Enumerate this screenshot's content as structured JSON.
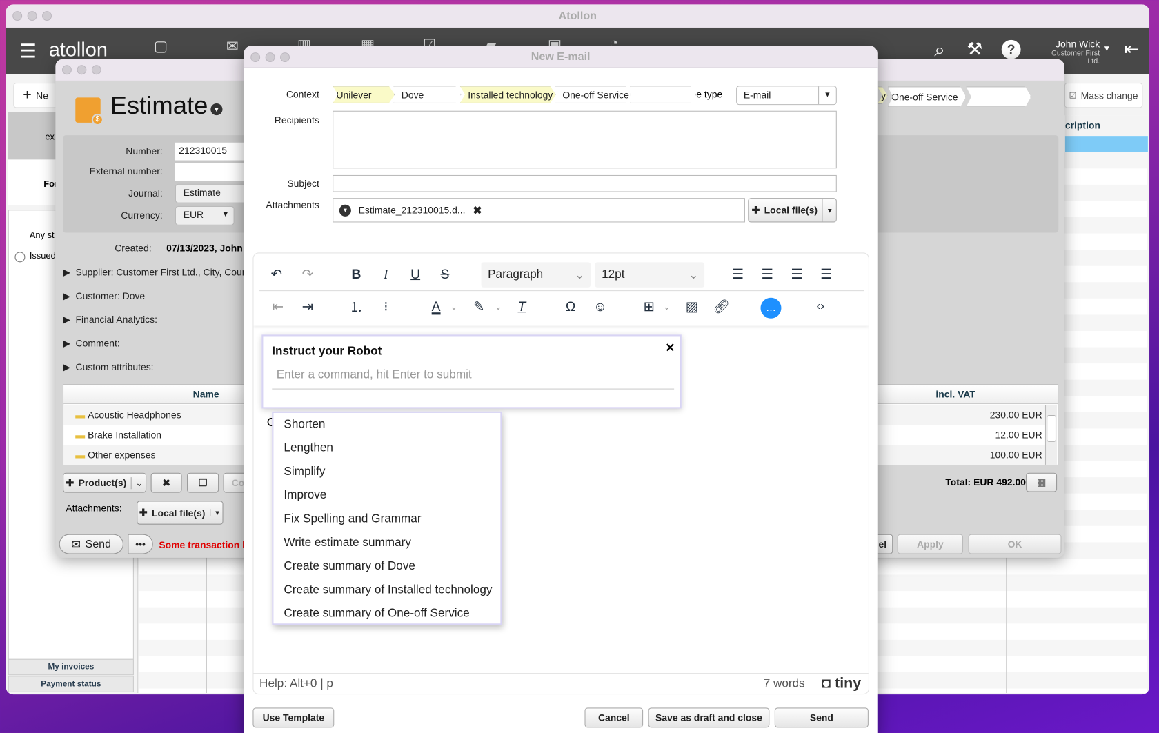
{
  "app": {
    "title": "Atollon",
    "logo": "atollon",
    "user_name": "John Wick",
    "user_company": "Customer First Ltd.",
    "new_button": "Ne",
    "mass_change": "Mass change",
    "list_column": "cription",
    "sidebar": {
      "partial_ex": "ex",
      "partial_for": "For",
      "any_status": "Any st",
      "issued": "Issued",
      "my_invoices": "My invoices",
      "payment_status": "Payment status"
    }
  },
  "estimate": {
    "title": "Estimate",
    "fields": {
      "number_label": "Number:",
      "number": "212310015",
      "external_label": "External number:",
      "external": "",
      "journal_label": "Journal:",
      "journal": "Estimate",
      "currency_label": "Currency:",
      "currency": "EUR",
      "created_label": "Created:",
      "created": "07/13/2023, John"
    },
    "sections": [
      "Supplier:  Customer First Ltd., City, Coun",
      "Customer:  Dove",
      "Financial Analytics:",
      "Comment:",
      "Custom attributes:"
    ],
    "context_right": [
      "y",
      "One-off Service",
      ""
    ],
    "table": {
      "headers": [
        "Name",
        "incl. VAT"
      ],
      "rows": [
        {
          "name": "Acoustic Headphones",
          "incl_vat": "230.00 EUR"
        },
        {
          "name": "Brake Installation",
          "incl_vat": "12.00 EUR"
        },
        {
          "name": "Other expenses",
          "incl_vat": "100.00 EUR"
        }
      ]
    },
    "product_button": "Product(s)",
    "co_button": "Co",
    "total": "Total: EUR 492.00",
    "attachments_label": "Attachments:",
    "local_files": "Local file(s)",
    "send": "Send",
    "more": "•••",
    "warning": "Some transaction h",
    "cancel_partial": "el",
    "apply": "Apply",
    "ok": "OK"
  },
  "email": {
    "title": "New E-mail",
    "context_label": "Context",
    "context": [
      {
        "label": "Unilever",
        "highlight": true
      },
      {
        "label": "Dove",
        "highlight": false
      },
      {
        "label": "Installed technology",
        "highlight": true
      },
      {
        "label": "One-off Service",
        "highlight": false
      },
      {
        "label": "",
        "highlight": false
      }
    ],
    "type_label": "e type",
    "type_value": "E-mail",
    "recipients_label": "Recipients",
    "recipients": "",
    "subject_label": "Subject",
    "subject": "",
    "attachments_label": "Attachments",
    "attachment": "Estimate_212310015.d...",
    "local_files": "Local file(s)",
    "editor": {
      "block_format": "Paragraph",
      "font_size": "12pt",
      "help": "Help: Alt+0 | p",
      "word_count": "7 words",
      "brand": "tiny",
      "body_partial": "C"
    },
    "robot": {
      "title": "Instruct your Robot",
      "placeholder": "Enter a command, hit Enter to submit",
      "commands": [
        "Shorten",
        "Lengthen",
        "Simplify",
        "Improve",
        "Fix Spelling and Grammar",
        "Write estimate summary",
        "Create summary of Dove",
        "Create summary of Installed technology",
        "Create summary of One-off Service"
      ]
    },
    "buttons": {
      "use_template": "Use Template",
      "cancel": "Cancel",
      "save_draft": "Save as draft and close",
      "send": "Send"
    }
  },
  "colors": {
    "accent_ai": "#1e90ff",
    "highlight_row": "#7ecbf7",
    "crumb_highlight": "#fafac8",
    "warning": "#e00000",
    "estimate_icon": "#f0a030"
  }
}
